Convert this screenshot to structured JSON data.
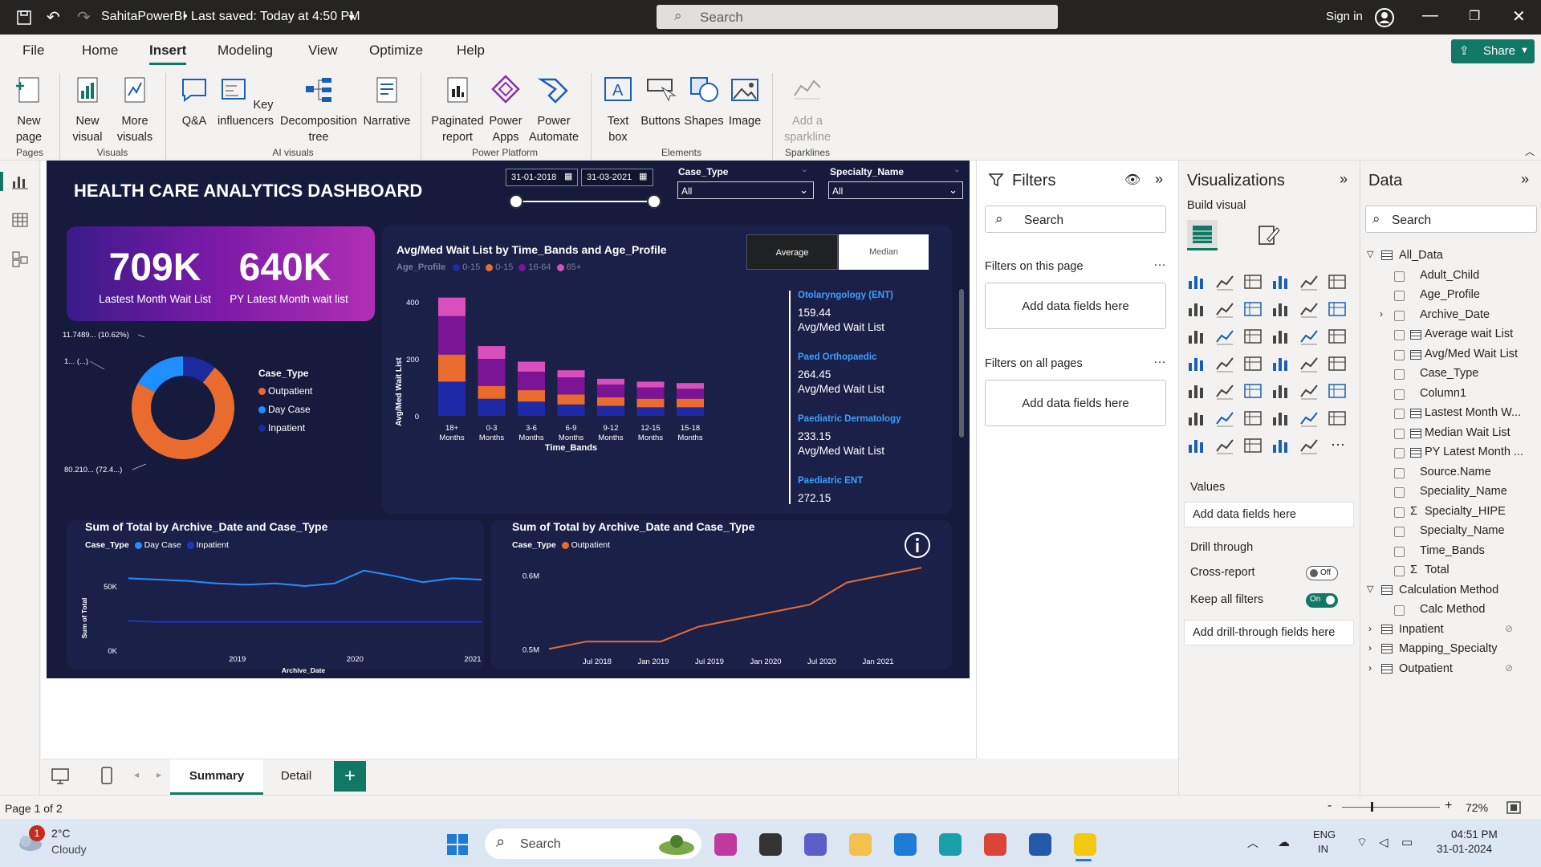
{
  "titlebar": {
    "file_name": "SahitaPowerBI",
    "saved": "• Last saved: Today at 4:50 PM",
    "search": "Search",
    "sign_in": "Sign in"
  },
  "menu": {
    "file": "File",
    "home": "Home",
    "insert": "Insert",
    "modeling": "Modeling",
    "view": "View",
    "optimize": "Optimize",
    "help": "Help",
    "share": "Share"
  },
  "ribbon": {
    "new_page": "New page",
    "new_visual": "New visual",
    "more_visuals": "More visuals",
    "qa": "Q&A",
    "key_influencers": "Key influencers",
    "decomposition_tree": "Decomposition tree",
    "narrative": "Narrative",
    "paginated_report": "Paginated report",
    "power_apps": "Power Apps",
    "power_automate": "Power Automate",
    "text_box": "Text box",
    "buttons": "Buttons",
    "shapes": "Shapes",
    "image": "Image",
    "add_sparkline": "Add a sparkline",
    "groups": {
      "pages": "Pages",
      "visuals": "Visuals",
      "ai_visuals": "AI visuals",
      "power_platform": "Power Platform",
      "elements": "Elements",
      "sparklines": "Sparklines"
    }
  },
  "dashboard": {
    "title": "HEALTH CARE ANALYTICS DASHBOARD",
    "date_from": "31-01-2018",
    "date_to": "31-03-2021",
    "case_type_label": "Case_Type",
    "case_type_value": "All",
    "specialty_label": "Specialty_Name",
    "specialty_value": "All",
    "kpi1_value": "709K",
    "kpi1_label": "Lastest Month Wait List",
    "kpi2_value": "640K",
    "kpi2_label": "PY Latest Month wait list",
    "donut": {
      "label_top": "11.7489... (10.62%)",
      "label_mid": "1... (...)",
      "label_bottom": "80.210... (72.4...)",
      "legend_title": "Case_Type",
      "legend": [
        "Outpatient",
        "Day Case",
        "Inpatient"
      ]
    },
    "bar_title": "Avg/Med Wait List by Time_Bands and Age_Profile",
    "toggle_avg": "Average",
    "toggle_med": "Median",
    "age_legend_title": "Age_Profile",
    "age_legend": [
      "0-15",
      "0-15",
      "16-64",
      "65+"
    ],
    "bar_ylabel": "Avg/Med Wait List",
    "bar_xlabel": "Time_Bands",
    "bar_yticks": [
      "400",
      "200",
      "0"
    ],
    "specialties": [
      {
        "name": "Otolaryngology (ENT)",
        "value": "159.44",
        "metric": "Avg/Med Wait List"
      },
      {
        "name": "Paed Orthopaedic",
        "value": "264.45",
        "metric": "Avg/Med Wait List"
      },
      {
        "name": "Paediatric Dermatology",
        "value": "233.15",
        "metric": "Avg/Med Wait List"
      },
      {
        "name": "Paediatric ENT",
        "value": "272.15",
        "metric": ""
      }
    ],
    "line1_title": "Sum of Total by Archive_Date and Case_Type",
    "line1_legend_title": "Case_Type",
    "line1_legend": [
      "Day Case",
      "Inpatient"
    ],
    "line1_ylabel": "Sum of Total",
    "line1_xlabel": "Archive_Date",
    "line1_yticks": [
      "50K",
      "0K"
    ],
    "line1_xticks": [
      "2019",
      "2020",
      "2021"
    ],
    "line2_title": "Sum of Total by Archive_Date and Case_Type",
    "line2_legend_title": "Case_Type",
    "line2_legend": [
      "Outpatient"
    ],
    "line2_yticks": [
      "0.6M",
      "0.5M"
    ],
    "line2_xticks": [
      "Jul 2018",
      "Jan 2019",
      "Jul 2019",
      "Jan 2020",
      "Jul 2020",
      "Jan 2021"
    ]
  },
  "chart_data": [
    {
      "type": "pie",
      "title": "",
      "categories": [
        "Outpatient",
        "Day Case",
        "Inpatient"
      ],
      "values": [
        72.4,
        16.98,
        10.62
      ],
      "colors": [
        "#ea6b2e",
        "#1f8fff",
        "#1b2a9e"
      ]
    },
    {
      "type": "bar",
      "title": "Avg/Med Wait List by Time_Bands and Age_Profile",
      "xlabel": "Time_Bands",
      "ylabel": "Avg/Med Wait List",
      "ylim": [
        0,
        450
      ],
      "categories": [
        "18+ Months",
        "0-3 Months",
        "3-6 Months",
        "6-9 Months",
        "9-12 Months",
        "12-15 Months",
        "15-18 Months"
      ],
      "series": [
        {
          "name": "0-15",
          "color": "#1f2aa8",
          "values": [
            120,
            60,
            50,
            40,
            35,
            30,
            30
          ]
        },
        {
          "name": "0-15",
          "color": "#ea6b2e",
          "values": [
            95,
            45,
            40,
            35,
            30,
            30,
            30
          ]
        },
        {
          "name": "16-64",
          "color": "#7b1596",
          "values": [
            135,
            95,
            65,
            60,
            45,
            40,
            35
          ]
        },
        {
          "name": "65+",
          "color": "#d94fbb",
          "values": [
            65,
            45,
            35,
            25,
            20,
            20,
            20
          ]
        }
      ]
    },
    {
      "type": "line",
      "title": "Sum of Total by Archive_Date and Case_Type",
      "xlabel": "Archive_Date",
      "ylabel": "Sum of Total",
      "x": [
        "2018-03",
        "2018-06",
        "2018-09",
        "2018-12",
        "2019-03",
        "2019-06",
        "2019-09",
        "2019-12",
        "2020-03",
        "2020-06",
        "2020-09",
        "2020-12",
        "2021-03"
      ],
      "series": [
        {
          "name": "Day Case",
          "color": "#1f8fff",
          "values": [
            56,
            55,
            54,
            52,
            51,
            52,
            50,
            52,
            62,
            58,
            53,
            56,
            55
          ]
        },
        {
          "name": "Inpatient",
          "color": "#2233c8",
          "values": [
            23,
            22,
            22,
            22,
            22,
            22,
            22,
            22,
            22,
            22,
            22,
            22,
            22
          ]
        }
      ]
    },
    {
      "type": "line",
      "title": "Sum of Total by Archive_Date and Case_Type",
      "x": [
        "2018-02",
        "2018-06",
        "2018-10",
        "2019-02",
        "2019-06",
        "2019-10",
        "2020-02",
        "2020-06",
        "2020-10",
        "2021-02",
        "2021-04"
      ],
      "series": [
        {
          "name": "Outpatient",
          "color": "#ea6b2e",
          "values": [
            0.5,
            0.51,
            0.51,
            0.51,
            0.53,
            0.54,
            0.55,
            0.56,
            0.59,
            0.6,
            0.61
          ]
        }
      ]
    }
  ],
  "filters": {
    "title": "Filters",
    "search": "Search",
    "on_page": "Filters on this page",
    "all_pages": "Filters on all pages",
    "add": "Add data fields here"
  },
  "viz": {
    "title": "Visualizations",
    "build": "Build visual",
    "values": "Values",
    "add_values": "Add data fields here",
    "drill": "Drill through",
    "cross_report": "Cross-report",
    "cross_off": "Off",
    "keep_all": "Keep all filters",
    "keep_on": "On",
    "add_drill": "Add drill-through fields here"
  },
  "data": {
    "title": "Data",
    "search": "Search",
    "table1": "All_Data",
    "fields": [
      "Adult_Child",
      "Age_Profile",
      "Archive_Date",
      "Average wait List",
      "Avg/Med Wait List",
      "Case_Type",
      "Column1",
      "Lastest Month W...",
      "Median Wait List",
      "PY Latest Month ...",
      "Source.Name",
      "Speciality_Name",
      "Specialty_HIPE",
      "Specialty_Name",
      "Time_Bands",
      "Total"
    ],
    "table2": "Calculation Method",
    "table2_field": "Calc Method",
    "table3": "Inpatient",
    "table4": "Mapping_Specialty",
    "table5": "Outpatient"
  },
  "tabs": {
    "summary": "Summary",
    "detail": "Detail"
  },
  "status": {
    "page": "Page 1 of 2",
    "zoom": "72%"
  },
  "taskbar": {
    "temp": "2°C",
    "weather": "Cloudy",
    "badge": "1",
    "search": "Search",
    "lang1": "ENG",
    "lang2": "IN",
    "time": "04:51 PM",
    "date": "31-01-2024"
  }
}
